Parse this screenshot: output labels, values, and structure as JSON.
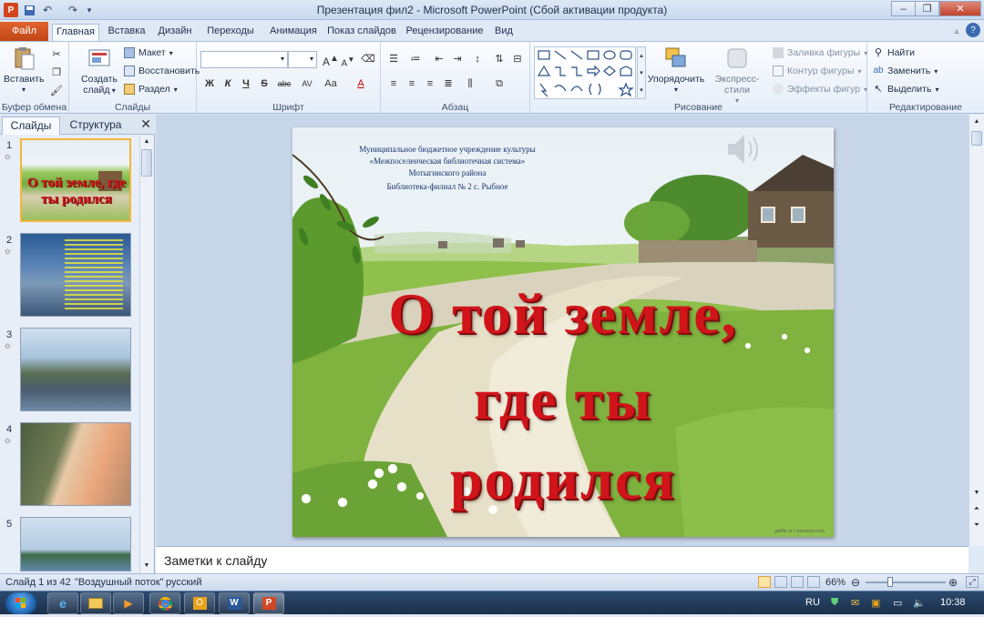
{
  "window": {
    "title": "Презентация фил2 - Microsoft PowerPoint (Сбой активации продукта)",
    "minimize_label": "–",
    "maximize_label": "❐",
    "close_label": "✕"
  },
  "ribbon_tabs": [
    "Файл",
    "Главная",
    "Вставка",
    "Дизайн",
    "Переходы",
    "Анимация",
    "Показ слайдов",
    "Рецензирование",
    "Вид"
  ],
  "ribbon": {
    "clipboard": {
      "paste": "Вставить",
      "group": "Буфер обмена"
    },
    "slides": {
      "new_slide_line1": "Создать",
      "new_slide_line2": "слайд",
      "layout": "Макет",
      "reset": "Восстановить",
      "section": "Раздел",
      "group": "Слайды"
    },
    "font": {
      "bold": "Ж",
      "italic": "К",
      "underline": "Ч",
      "strike": "S",
      "shadow": "abc",
      "spacing": "AV",
      "case": "Aa",
      "color": "A",
      "group": "Шрифт"
    },
    "paragraph": {
      "group": "Абзац"
    },
    "drawing": {
      "arrange": "Упорядочить",
      "quick_styles": "Экспресс-стили",
      "fill": "Заливка фигуры",
      "outline": "Контур фигуры",
      "effects": "Эффекты фигур",
      "group": "Рисование"
    },
    "editing": {
      "find": "Найти",
      "replace": "Заменить",
      "select": "Выделить",
      "group": "Редактирование"
    }
  },
  "panel": {
    "tab_slides": "Слайды",
    "tab_outline": "Структура",
    "close": "✕"
  },
  "thumbnails": [
    {
      "num": "1",
      "title": "О той земле, где ты родился"
    },
    {
      "num": "2"
    },
    {
      "num": "3"
    },
    {
      "num": "4"
    },
    {
      "num": "5"
    }
  ],
  "slide": {
    "header_lines": [
      "Муниципальное бюджетное учреждение культуры",
      "«Межпоселенческая библиотечная система»",
      "Мотыгинского района",
      "Библиотека-филиал № 2 с. Рыбное"
    ],
    "title_lines": [
      "О той земле,",
      "где ты",
      "родился"
    ],
    "watermark": "pptfile.ru / voronova.com"
  },
  "notes_placeholder": "Заметки к слайду",
  "status": {
    "slide_info": "Слайд 1 из 42",
    "theme": "\"Воздушный поток\"",
    "language": "русский",
    "zoom": "66%"
  },
  "tray": {
    "lang": "RU",
    "time": "10:38"
  },
  "colors": {
    "file_tab": "#d04a1a",
    "title_red": "#d0141a",
    "accent_blue": "#2b579a"
  }
}
